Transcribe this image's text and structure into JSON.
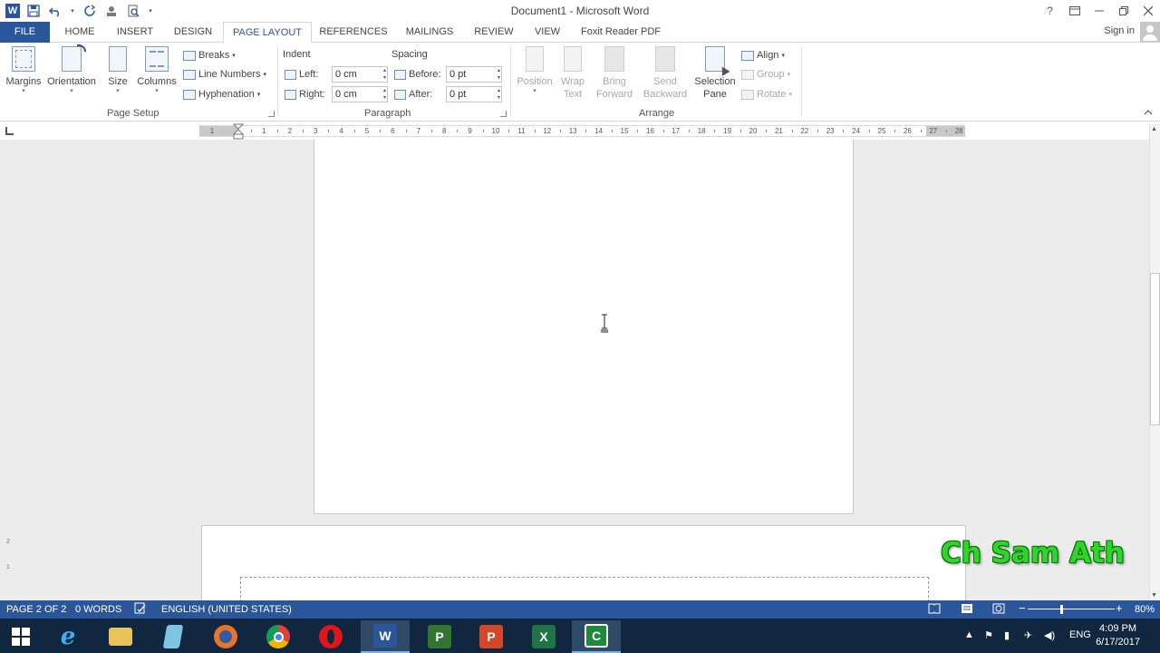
{
  "titlebar": {
    "title": "Document1 - Microsoft Word",
    "qat_icons": [
      "word-app-icon",
      "save-icon",
      "undo-icon",
      "redo-icon",
      "touch-mode-icon",
      "print-preview-icon",
      "customize-qat-icon"
    ],
    "help": "?",
    "controls": [
      "ribbon-display-options",
      "minimize",
      "restore",
      "close"
    ]
  },
  "tabs": {
    "file": "FILE",
    "home": "HOME",
    "insert": "INSERT",
    "design": "DESIGN",
    "page_layout": "PAGE LAYOUT",
    "references": "REFERENCES",
    "mailings": "MAILINGS",
    "review": "REVIEW",
    "view": "VIEW",
    "foxit": "Foxit Reader PDF",
    "sign_in": "Sign in"
  },
  "ribbon": {
    "page_setup": {
      "label": "Page Setup",
      "margins": "Margins",
      "orientation": "Orientation",
      "size": "Size",
      "columns": "Columns",
      "breaks": "Breaks",
      "line_numbers": "Line Numbers",
      "hyphenation": "Hyphenation"
    },
    "paragraph": {
      "label": "Paragraph",
      "indent_head": "Indent",
      "spacing_head": "Spacing",
      "left_label": "Left:",
      "left_value": "0 cm",
      "right_label": "Right:",
      "right_value": "0 cm",
      "before_label": "Before:",
      "before_value": "0 pt",
      "after_label": "After:",
      "after_value": "0 pt"
    },
    "arrange": {
      "label": "Arrange",
      "position": "Position",
      "wrap_text_1": "Wrap",
      "wrap_text_2": "Text",
      "bring_forward_1": "Bring",
      "bring_forward_2": "Forward",
      "send_backward_1": "Send",
      "send_backward_2": "Backward",
      "selection_pane_1": "Selection",
      "selection_pane_2": "Pane",
      "align": "Align",
      "group": "Group",
      "rotate": "Rotate"
    }
  },
  "ruler": {
    "numbers": [
      "1",
      "1",
      "2",
      "3",
      "4",
      "5",
      "6",
      "7",
      "8",
      "9",
      "10",
      "11",
      "12",
      "13",
      "14",
      "15",
      "16",
      "17",
      "18",
      "19",
      "20",
      "21",
      "22",
      "23",
      "24",
      "25",
      "26",
      "27",
      "28"
    ]
  },
  "vertical_ruler": {
    "numbers": [
      "2",
      "1"
    ]
  },
  "watermark": "Ch Sam Ath",
  "status": {
    "page": "PAGE 2 OF 2",
    "words": "0 WORDS",
    "language": "ENGLISH (UNITED STATES)",
    "zoom": "80%",
    "zoom_level": 0.8
  },
  "taskbar": {
    "apps": [
      "start",
      "internet-explorer",
      "file-explorer",
      "notepad",
      "firefox",
      "chrome",
      "opera",
      "word",
      "project",
      "powerpoint",
      "excel",
      "camtasia"
    ],
    "active_app": "word",
    "lang": "ENG",
    "time": "4:09 PM",
    "date": "6/17/2017"
  },
  "colors": {
    "accent": "#2b579a",
    "watermark": "#2fd62a",
    "taskbar": "#10273f"
  }
}
